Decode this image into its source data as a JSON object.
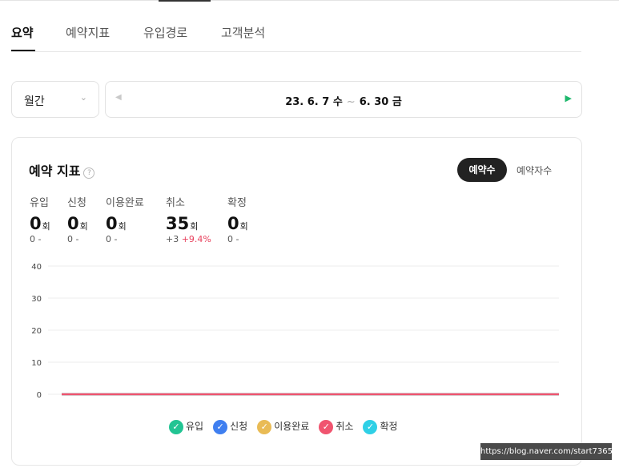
{
  "tabs": [
    {
      "label": "요약",
      "active": true
    },
    {
      "label": "예약지표",
      "active": false
    },
    {
      "label": "유입경로",
      "active": false
    },
    {
      "label": "고객분석",
      "active": false
    }
  ],
  "period": {
    "selected": "월간"
  },
  "date_range": {
    "start": "23. 6. 7 수",
    "separator": "~",
    "end": "6. 30 금"
  },
  "card": {
    "title": "예약 지표",
    "help_glyph": "?",
    "toggle": {
      "active": "예약수",
      "inactive": "예약자수"
    }
  },
  "metrics": [
    {
      "label": "유입",
      "value": "0",
      "unit": "회",
      "change": "0 -",
      "pct": ""
    },
    {
      "label": "신청",
      "value": "0",
      "unit": "회",
      "change": "0 -",
      "pct": ""
    },
    {
      "label": "이용완료",
      "value": "0",
      "unit": "회",
      "change": "0 -",
      "pct": ""
    },
    {
      "label": "취소",
      "value": "35",
      "unit": "회",
      "change": "+3",
      "pct": "+9.4%"
    },
    {
      "label": "확정",
      "value": "0",
      "unit": "회",
      "change": "0 -",
      "pct": ""
    }
  ],
  "chart_data": {
    "type": "line",
    "ylim": [
      0,
      40
    ],
    "yticks": [
      "40",
      "30",
      "20",
      "10",
      "0"
    ],
    "series": [
      {
        "name": "유입",
        "color": "#22c493"
      },
      {
        "name": "신청",
        "color": "#3f7ff0"
      },
      {
        "name": "이용완료",
        "color": "#e9bb55"
      },
      {
        "name": "취소",
        "color": "#f0546f"
      },
      {
        "name": "확정",
        "color": "#2fd0e6"
      }
    ],
    "grid": true,
    "legend": "bottom"
  },
  "watermark": "https://blog.naver.com/start7365"
}
